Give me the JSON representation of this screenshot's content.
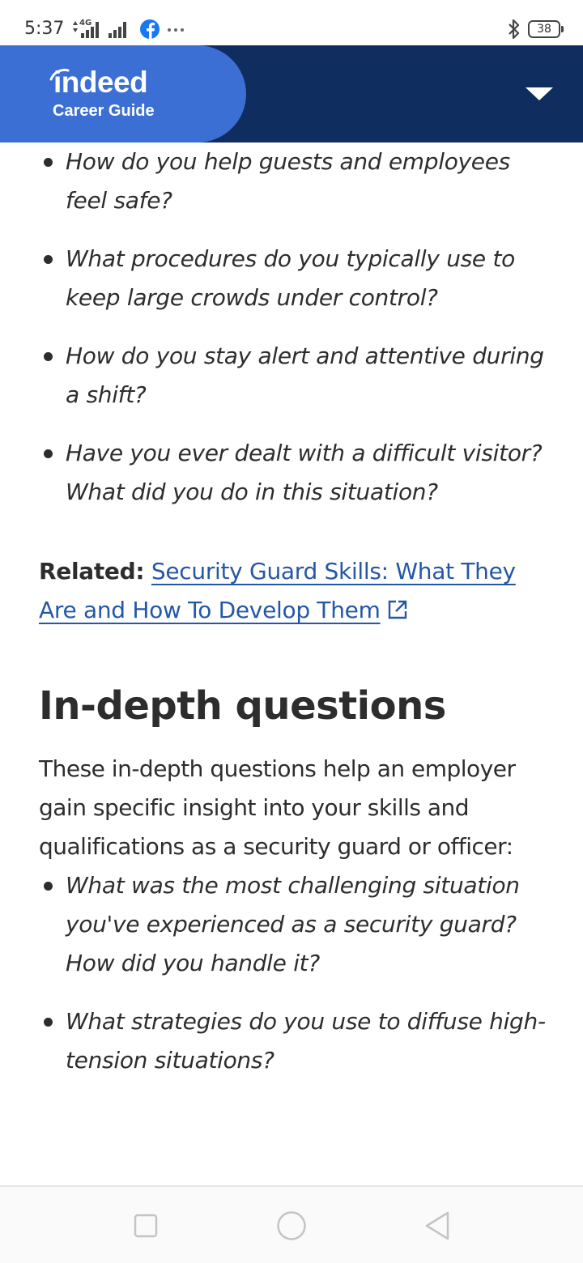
{
  "status_bar": {
    "time": "5:37",
    "network_type": "4G",
    "battery_level": "38"
  },
  "header": {
    "logo_text": "indeed",
    "logo_subtitle": "Career Guide",
    "brand_color": "#3b6fd4",
    "header_color": "#0f2d5e"
  },
  "article": {
    "list_1": [
      "How do you help guests and employees feel safe?",
      "What procedures do you typically use to keep large crowds under control?",
      "How do you stay alert and attentive during a shift?",
      "Have you ever dealt with a difficult visitor? What did you do in this situation?"
    ],
    "related": {
      "label": "Related:",
      "link_text": "Security Guard Skills: What They Are and How To Develop Them",
      "link_color": "#2557a7"
    },
    "section_title": "In-depth questions",
    "intro": "These in-depth questions help an employer gain specific insight into your skills and qualifications as a security guard or officer:",
    "list_2": [
      "What was the most challenging situation you've experienced as a security guard? How did you handle it?",
      "What strategies do you use to diffuse high-tension situations?"
    ]
  },
  "icons": {
    "network": "signal-icon",
    "app_notification": "facebook-icon",
    "bluetooth": "bluetooth-icon",
    "menu": "chevron-down-icon",
    "external_link": "external-link-icon",
    "nav_recent": "recent-apps-icon",
    "nav_home": "home-icon",
    "nav_back": "back-icon"
  }
}
